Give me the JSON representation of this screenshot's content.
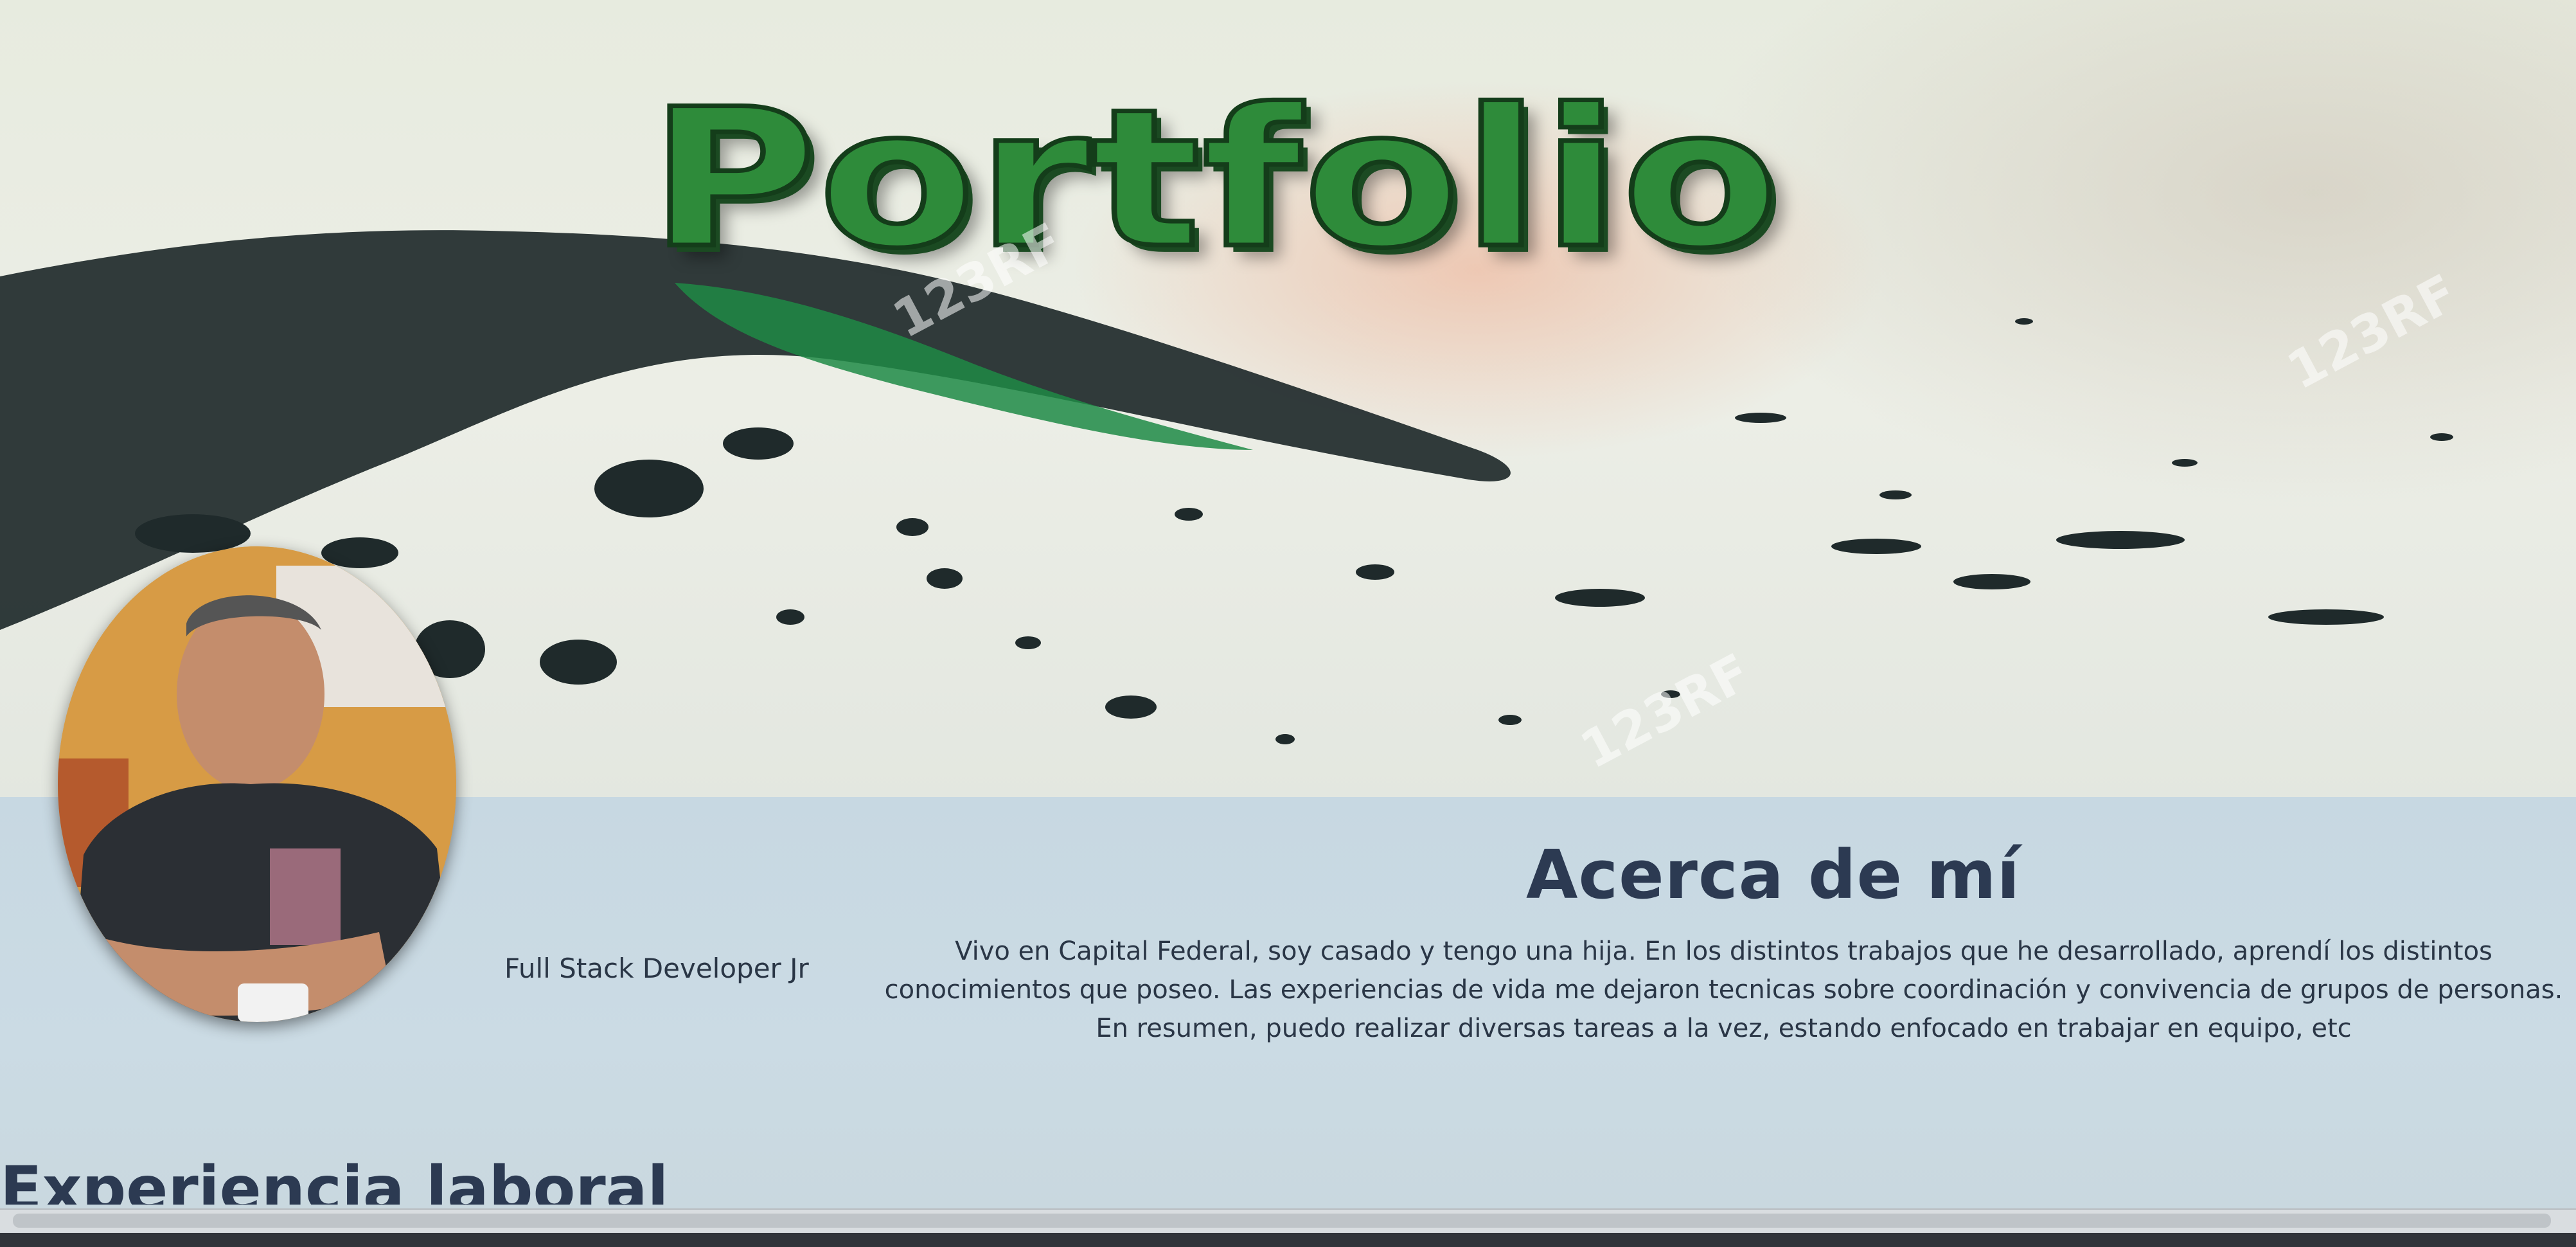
{
  "banner": {
    "title": "Portfolio",
    "watermark": "123RF"
  },
  "profile": {
    "role": "Full Stack Developer Jr"
  },
  "about": {
    "heading": "Acerca de mí",
    "text": "Vivo en Capital Federal, soy casado y tengo una hija. En los distintos trabajos que he desarrollado, aprendí los distintos conocimientos que poseo. Las experiencias de vida me dejaron tecnicas sobre coordinación y convivencia de grupos de personas. En resumen, puedo realizar diversas tareas a la vez, estando enfocado en trabajar en equipo, etc"
  },
  "experience": {
    "heading": "Experiencia laboral"
  },
  "colors": {
    "title_green": "#2e8b3a",
    "section_bg": "#c9d9e3",
    "heading_text": "#2c3a52"
  }
}
